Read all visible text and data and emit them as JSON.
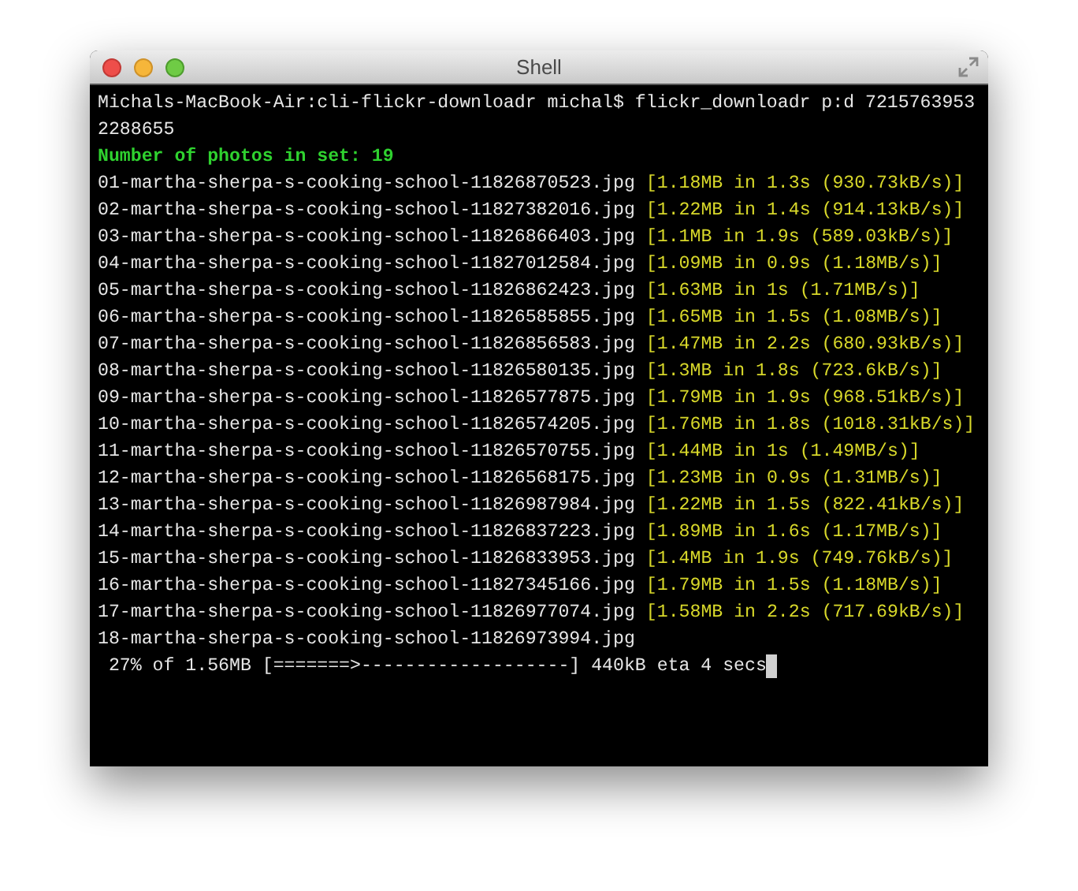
{
  "window": {
    "title": "Shell"
  },
  "terminal": {
    "lines": [
      {
        "kind": "plain",
        "text": "Michals-MacBook-Air:cli-flickr-downloadr michal$ flickr_downloadr p:d 7215763953"
      },
      {
        "kind": "plain",
        "text": "2288655"
      },
      {
        "kind": "info",
        "text": "Number of photos in set: 19"
      },
      {
        "kind": "file",
        "name": "01-martha-sherpa-s-cooking-school-11826870523.jpg",
        "stats": "[1.18MB in 1.3s (930.73kB/s)]"
      },
      {
        "kind": "file",
        "name": "02-martha-sherpa-s-cooking-school-11827382016.jpg",
        "stats": "[1.22MB in 1.4s (914.13kB/s)]"
      },
      {
        "kind": "file",
        "name": "03-martha-sherpa-s-cooking-school-11826866403.jpg",
        "stats": "[1.1MB in 1.9s (589.03kB/s)]"
      },
      {
        "kind": "file",
        "name": "04-martha-sherpa-s-cooking-school-11827012584.jpg",
        "stats": "[1.09MB in 0.9s (1.18MB/s)]"
      },
      {
        "kind": "file",
        "name": "05-martha-sherpa-s-cooking-school-11826862423.jpg",
        "stats": "[1.63MB in 1s (1.71MB/s)]"
      },
      {
        "kind": "file",
        "name": "06-martha-sherpa-s-cooking-school-11826585855.jpg",
        "stats": "[1.65MB in 1.5s (1.08MB/s)]"
      },
      {
        "kind": "file",
        "name": "07-martha-sherpa-s-cooking-school-11826856583.jpg",
        "stats": "[1.47MB in 2.2s (680.93kB/s)]"
      },
      {
        "kind": "file",
        "name": "08-martha-sherpa-s-cooking-school-11826580135.jpg",
        "stats": "[1.3MB in 1.8s (723.6kB/s)]"
      },
      {
        "kind": "file",
        "name": "09-martha-sherpa-s-cooking-school-11826577875.jpg",
        "stats": "[1.79MB in 1.9s (968.51kB/s)]"
      },
      {
        "kind": "file",
        "name": "10-martha-sherpa-s-cooking-school-11826574205.jpg",
        "stats": "[1.76MB in 1.8s (1018.31kB/s)]"
      },
      {
        "kind": "file",
        "name": "11-martha-sherpa-s-cooking-school-11826570755.jpg",
        "stats": "[1.44MB in 1s (1.49MB/s)]"
      },
      {
        "kind": "file",
        "name": "12-martha-sherpa-s-cooking-school-11826568175.jpg",
        "stats": "[1.23MB in 0.9s (1.31MB/s)]"
      },
      {
        "kind": "file",
        "name": "13-martha-sherpa-s-cooking-school-11826987984.jpg",
        "stats": "[1.22MB in 1.5s (822.41kB/s)]"
      },
      {
        "kind": "file",
        "name": "14-martha-sherpa-s-cooking-school-11826837223.jpg",
        "stats": "[1.89MB in 1.6s (1.17MB/s)]"
      },
      {
        "kind": "file",
        "name": "15-martha-sherpa-s-cooking-school-11826833953.jpg",
        "stats": "[1.4MB in 1.9s (749.76kB/s)]"
      },
      {
        "kind": "file",
        "name": "16-martha-sherpa-s-cooking-school-11827345166.jpg",
        "stats": "[1.79MB in 1.5s (1.18MB/s)]"
      },
      {
        "kind": "file",
        "name": "17-martha-sherpa-s-cooking-school-11826977074.jpg",
        "stats": "[1.58MB in 2.2s (717.69kB/s)]"
      },
      {
        "kind": "plain",
        "text": "18-martha-sherpa-s-cooking-school-11826973994.jpg"
      },
      {
        "kind": "progress",
        "text": " 27% of 1.56MB [=======>-------------------] 440kB eta 4 secs"
      }
    ]
  }
}
